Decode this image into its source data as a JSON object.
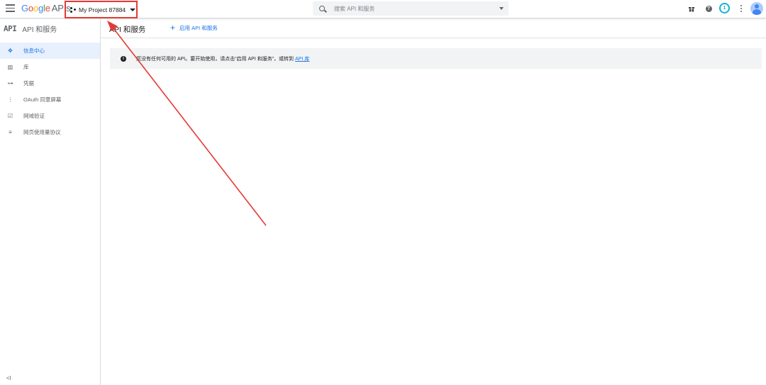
{
  "header": {
    "logo_google": "Google",
    "logo_apis": "APIs",
    "project_name": "My Project 87884",
    "search_placeholder": "搜索 API 和服务",
    "notification_count": "1"
  },
  "sidebar": {
    "logo": "API",
    "title": "API 和服务",
    "items": [
      {
        "label": "信息中心",
        "icon": "dashboard-icon"
      },
      {
        "label": "库",
        "icon": "library-icon"
      },
      {
        "label": "凭据",
        "icon": "key-icon"
      },
      {
        "label": "OAuth 同意屏幕",
        "icon": "consent-icon"
      },
      {
        "label": "网域验证",
        "icon": "domain-icon"
      },
      {
        "label": "网页使用量协议",
        "icon": "settings-icon"
      }
    ],
    "collapse_glyph": "<I"
  },
  "main": {
    "title": "API 和服务",
    "enable_label": "启用 API 和服务",
    "banner_text": "您没有任何可用的 API。要开始使用，请点击“启用 API 和服务”，或转到",
    "banner_link": "API 库"
  },
  "colors": {
    "accent": "#1a73e8",
    "highlight_box": "#e53935",
    "annotation_arrow": "#e53935"
  }
}
